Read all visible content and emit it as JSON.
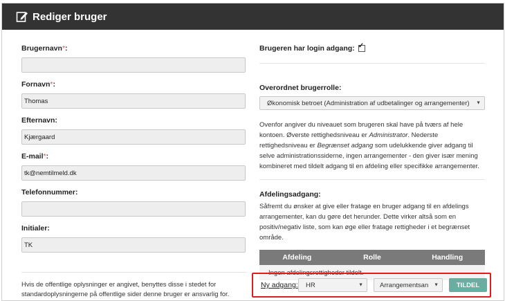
{
  "header": {
    "title": "Rediger bruger",
    "icon": "edit-icon"
  },
  "form": {
    "username": {
      "label": "Brugernavn",
      "required": "*",
      "suffix": ":",
      "value": ""
    },
    "firstname": {
      "label": "Fornavn",
      "required": "*",
      "suffix": ":",
      "value": "Thomas"
    },
    "lastname": {
      "label": "Efternavn:",
      "value": "Kjærgaard"
    },
    "email": {
      "label": "E-mail",
      "required": "*",
      "suffix": ":",
      "value": "tk@nemtilmeld.dk"
    },
    "phone": {
      "label": "Telefonnummer:",
      "value": ""
    },
    "initials": {
      "label": "Initialer:",
      "value": "TK"
    },
    "note": "Hvis de offentlige oplysninger er angivet, benyttes disse i stedet for standardoplysningerne på offentlige sider denne bruger er ansvarlig for."
  },
  "login": {
    "label": "Brugeren har login adgang:",
    "checked": true
  },
  "role": {
    "title": "Overordnet brugerrolle:",
    "selected": "Økonomisk betroet (Administration af udbetalinger og arrangementer)",
    "desc_parts": {
      "p1": "Ovenfor angiver du niveauet som brugeren skal have på tværs af hele kontoen. Øverste rettighedsniveau er ",
      "em1": "Administrator",
      "p2": ". Nederste rettighedsniveau er ",
      "em2": "Begrænset adgang",
      "p3": " som udelukkende giver adgang til selve administrationssiderne, ingen arrangementer - den giver især mening kombineret med tildelt adgang til en afdeling eller specifikke arrangementer."
    }
  },
  "department": {
    "title": "Afdelingsadgang:",
    "desc": "Såfremt du ønsker at give eller fratage en bruger adgang til en afdelings arrangementer, kan du gøre det herunder. Dette virker altså som en positiv/negativ liste, som kan øge eller fratage rettigheder i et begrænset område.",
    "table": {
      "headers": [
        "Afdeling",
        "Rolle",
        "Handling"
      ],
      "empty_text": "Ingen afdelingsrettigheder tildelt."
    },
    "assign": {
      "label": "Ny adgang:",
      "department_selected": "HR",
      "role_selected": "Arrangementsan",
      "button": "TILDEL"
    }
  },
  "colors": {
    "header_bg": "#333333",
    "table_header_bg": "#7a7a7a",
    "button_bg": "#6aaea2",
    "highlight_border": "#e01b1b",
    "required": "#d9534f"
  }
}
